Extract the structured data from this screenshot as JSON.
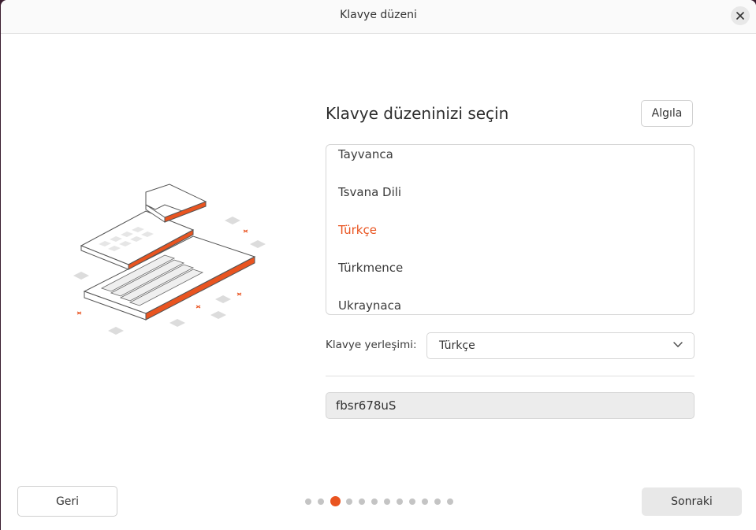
{
  "window": {
    "title": "Klavye düzeni"
  },
  "icons": {
    "close": "close-icon",
    "dropdown": "chevron-down-icon",
    "illustration": "keyboard-illustration"
  },
  "colors": {
    "accent": "#e95420",
    "window_bg": "#ffffff",
    "field_bg": "#ececec"
  },
  "main": {
    "heading": "Klavye düzeninizi seçin",
    "detect_label": "Algıla",
    "layouts": [
      {
        "label": "Tayvanca",
        "selected": false
      },
      {
        "label": "Tsvana Dili",
        "selected": false
      },
      {
        "label": "Türkçe",
        "selected": true
      },
      {
        "label": "Türkmence",
        "selected": false
      },
      {
        "label": "Ukraynaca",
        "selected": false
      }
    ],
    "variant_label": "Klavye yerleşimi:",
    "variant_value": "Türkçe",
    "test_input_value": "fbsr678uS"
  },
  "footer": {
    "back_label": "Geri",
    "next_label": "Sonraki",
    "steps_total": 12,
    "current_step": 3
  }
}
